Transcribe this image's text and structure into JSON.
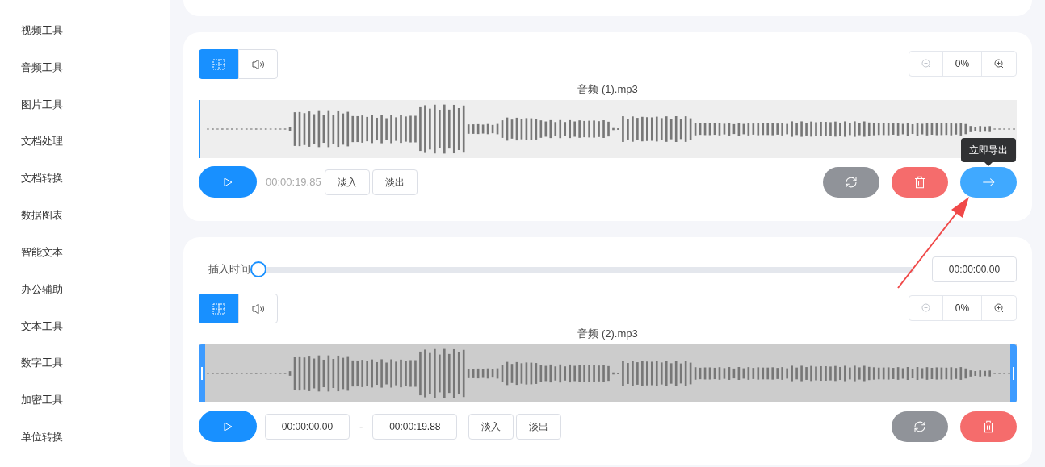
{
  "sidebar": {
    "items": [
      {
        "label": "视频工具",
        "selected": false
      },
      {
        "label": "音频工具",
        "selected": false
      },
      {
        "label": "图片工具",
        "selected": false
      },
      {
        "label": "文档处理",
        "selected": false
      },
      {
        "label": "文档转换",
        "selected": false
      },
      {
        "label": "数据图表",
        "selected": false
      },
      {
        "label": "智能文本",
        "selected": false
      },
      {
        "label": "办公辅助",
        "selected": false
      },
      {
        "label": "文本工具",
        "selected": false
      },
      {
        "label": "数字工具",
        "selected": false
      },
      {
        "label": "加密工具",
        "selected": false
      },
      {
        "label": "单位转换",
        "selected": false
      }
    ]
  },
  "tracks": [
    {
      "view_tabs": [
        {
          "kind": "split",
          "selected": true
        },
        {
          "kind": "volume",
          "selected": false
        }
      ],
      "zoom": "0%",
      "filename": "音频 (1).mp3",
      "region_selected": false,
      "position": "00:00:19.85",
      "fade": [
        "淡入",
        "淡出"
      ],
      "actions": [
        {
          "kind": "reload"
        },
        {
          "kind": "delete"
        },
        {
          "kind": "export",
          "tooltip": "立即导出"
        }
      ]
    },
    {
      "insert": {
        "label": "插入时间",
        "level": 0,
        "value": "00:00:00.00"
      },
      "view_tabs": [
        {
          "kind": "split",
          "selected": true
        },
        {
          "kind": "volume",
          "selected": false
        }
      ],
      "zoom": "0%",
      "filename": "音频 (2).mp3",
      "region_selected": true,
      "range": {
        "start": "00:00:00.00",
        "separator": "-",
        "end": "00:00:19.88"
      },
      "fade": [
        "淡入",
        "淡出"
      ],
      "actions": [
        {
          "kind": "reload"
        },
        {
          "kind": "delete"
        }
      ]
    }
  ]
}
